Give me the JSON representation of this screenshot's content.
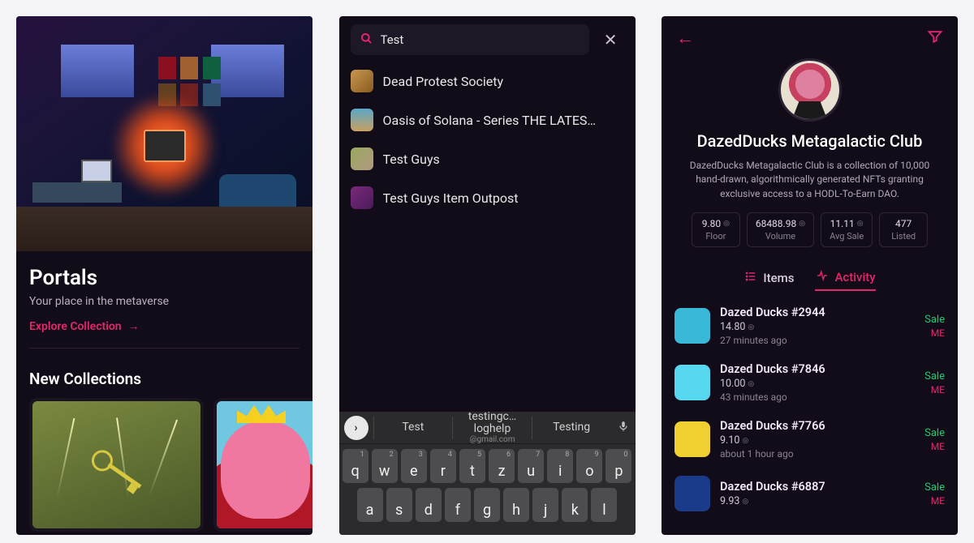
{
  "screen1": {
    "hero_title": "Portals",
    "hero_subtitle": "Your place in the metaverse",
    "explore_label": "Explore Collection",
    "new_section": "New Collections"
  },
  "screen2": {
    "search_value": "Test",
    "results": [
      {
        "label": "Dead Protest Society",
        "bg": "linear-gradient(135deg,#c89850,#8a5a20)"
      },
      {
        "label": "Oasis of Solana - Series THE LATES…",
        "bg": "linear-gradient(180deg,#5aa8c8,#c8a060)"
      },
      {
        "label": "Test Guys",
        "bg": "linear-gradient(135deg,#9aa860,#b09a80)"
      },
      {
        "label": "Test Guys Item Outpost",
        "bg": "linear-gradient(135deg,#7a2a7a,#4a1a5a)"
      }
    ],
    "suggestions": {
      "s1": "Test",
      "s2_top": "testingc…loghelp",
      "s2_bot": "@gmail.com",
      "s3": "Testing"
    },
    "kb_row1": [
      [
        "q",
        "1"
      ],
      [
        "w",
        "2"
      ],
      [
        "e",
        "3"
      ],
      [
        "r",
        "4"
      ],
      [
        "t",
        "5"
      ],
      [
        "z",
        "6"
      ],
      [
        "u",
        "7"
      ],
      [
        "i",
        "8"
      ],
      [
        "o",
        "9"
      ],
      [
        "p",
        "0"
      ]
    ],
    "kb_row2": [
      "a",
      "s",
      "d",
      "f",
      "g",
      "h",
      "j",
      "k",
      "l"
    ]
  },
  "screen3": {
    "title": "DazedDucks Metagalactic Club",
    "desc": "DazedDucks Metagalactic Club is a collection of 10,000 hand-drawn, algorithmically generated NFTs granting exclusive access to a HODL-To-Earn DAO.",
    "stats": [
      {
        "value": "9.80",
        "unit": "◎",
        "label": "Floor"
      },
      {
        "value": "68488.98",
        "unit": "◎",
        "label": "Volume"
      },
      {
        "value": "11.11",
        "unit": "◎",
        "label": "Avg Sale"
      },
      {
        "value": "477",
        "unit": "",
        "label": "Listed"
      }
    ],
    "tab_items": "Items",
    "tab_activity": "Activity",
    "activity": [
      {
        "title": "Dazed Ducks #2944",
        "price": "14.80",
        "time": "27 minutes ago",
        "type": "Sale",
        "src": "ME",
        "bg": "#3ab8d8"
      },
      {
        "title": "Dazed Ducks #7846",
        "price": "10.00",
        "time": "43 minutes ago",
        "type": "Sale",
        "src": "ME",
        "bg": "#58d8f0"
      },
      {
        "title": "Dazed Ducks #7766",
        "price": "9.10",
        "time": "about 1 hour ago",
        "type": "Sale",
        "src": "ME",
        "bg": "#f0d030"
      },
      {
        "title": "Dazed Ducks #6887",
        "price": "9.93",
        "time": "",
        "type": "Sale",
        "src": "ME",
        "bg": "#1a3a8a"
      }
    ]
  }
}
